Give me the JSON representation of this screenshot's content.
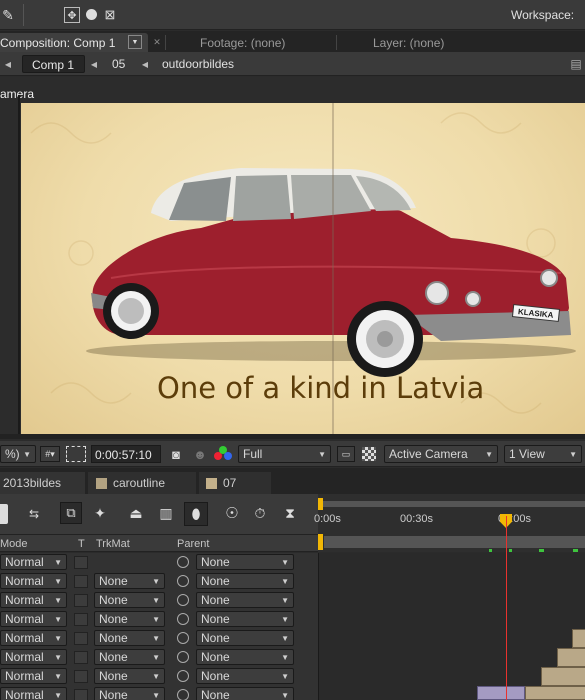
{
  "header": {
    "workspace_label": "Workspace:"
  },
  "panel_tabs": {
    "composition": "Composition: Comp 1",
    "footage": "Footage: (none)",
    "layer": "Layer: (none)"
  },
  "breadcrumb": {
    "items": [
      "Comp 1",
      "05",
      "outdoorbildes"
    ]
  },
  "viewer": {
    "camera_label": "amera",
    "overlay_text": "One of a kind in Latvia",
    "plate_text": "KLASIKA",
    "bg_color": "#efdcaa",
    "car_color": "#9d1f2d"
  },
  "viewer_controls": {
    "zoom": "%)",
    "timecode": "0:00:57:10",
    "resolution": "Full",
    "camera": "Active Camera",
    "views": "1 View"
  },
  "timeline_tabs": [
    "2013bildes",
    "caroutline",
    "07"
  ],
  "timeline_tab_colors": [
    "#a99a7a",
    "#b3a382",
    "#c3b08a"
  ],
  "ruler": {
    "labels": [
      "0:00s",
      "00:30s",
      "01:00s"
    ]
  },
  "columns": {
    "mode": "Mode",
    "t": "T",
    "trkmat": "TrkMat",
    "parent": "Parent"
  },
  "layers": [
    {
      "mode": "Normal",
      "trkmat": "",
      "parent": "None"
    },
    {
      "mode": "Normal",
      "trkmat": "None",
      "parent": "None"
    },
    {
      "mode": "Normal",
      "trkmat": "None",
      "parent": "None"
    },
    {
      "mode": "Normal",
      "trkmat": "None",
      "parent": "None"
    },
    {
      "mode": "Normal",
      "trkmat": "None",
      "parent": "None"
    },
    {
      "mode": "Normal",
      "trkmat": "None",
      "parent": "None"
    },
    {
      "mode": "Normal",
      "trkmat": "None",
      "parent": "None"
    },
    {
      "mode": "Normal",
      "trkmat": "None",
      "parent": "None"
    }
  ],
  "accent": {
    "playhead": "#e8322e",
    "marker": "#f2b705",
    "keyframe": "#3ec43e"
  }
}
